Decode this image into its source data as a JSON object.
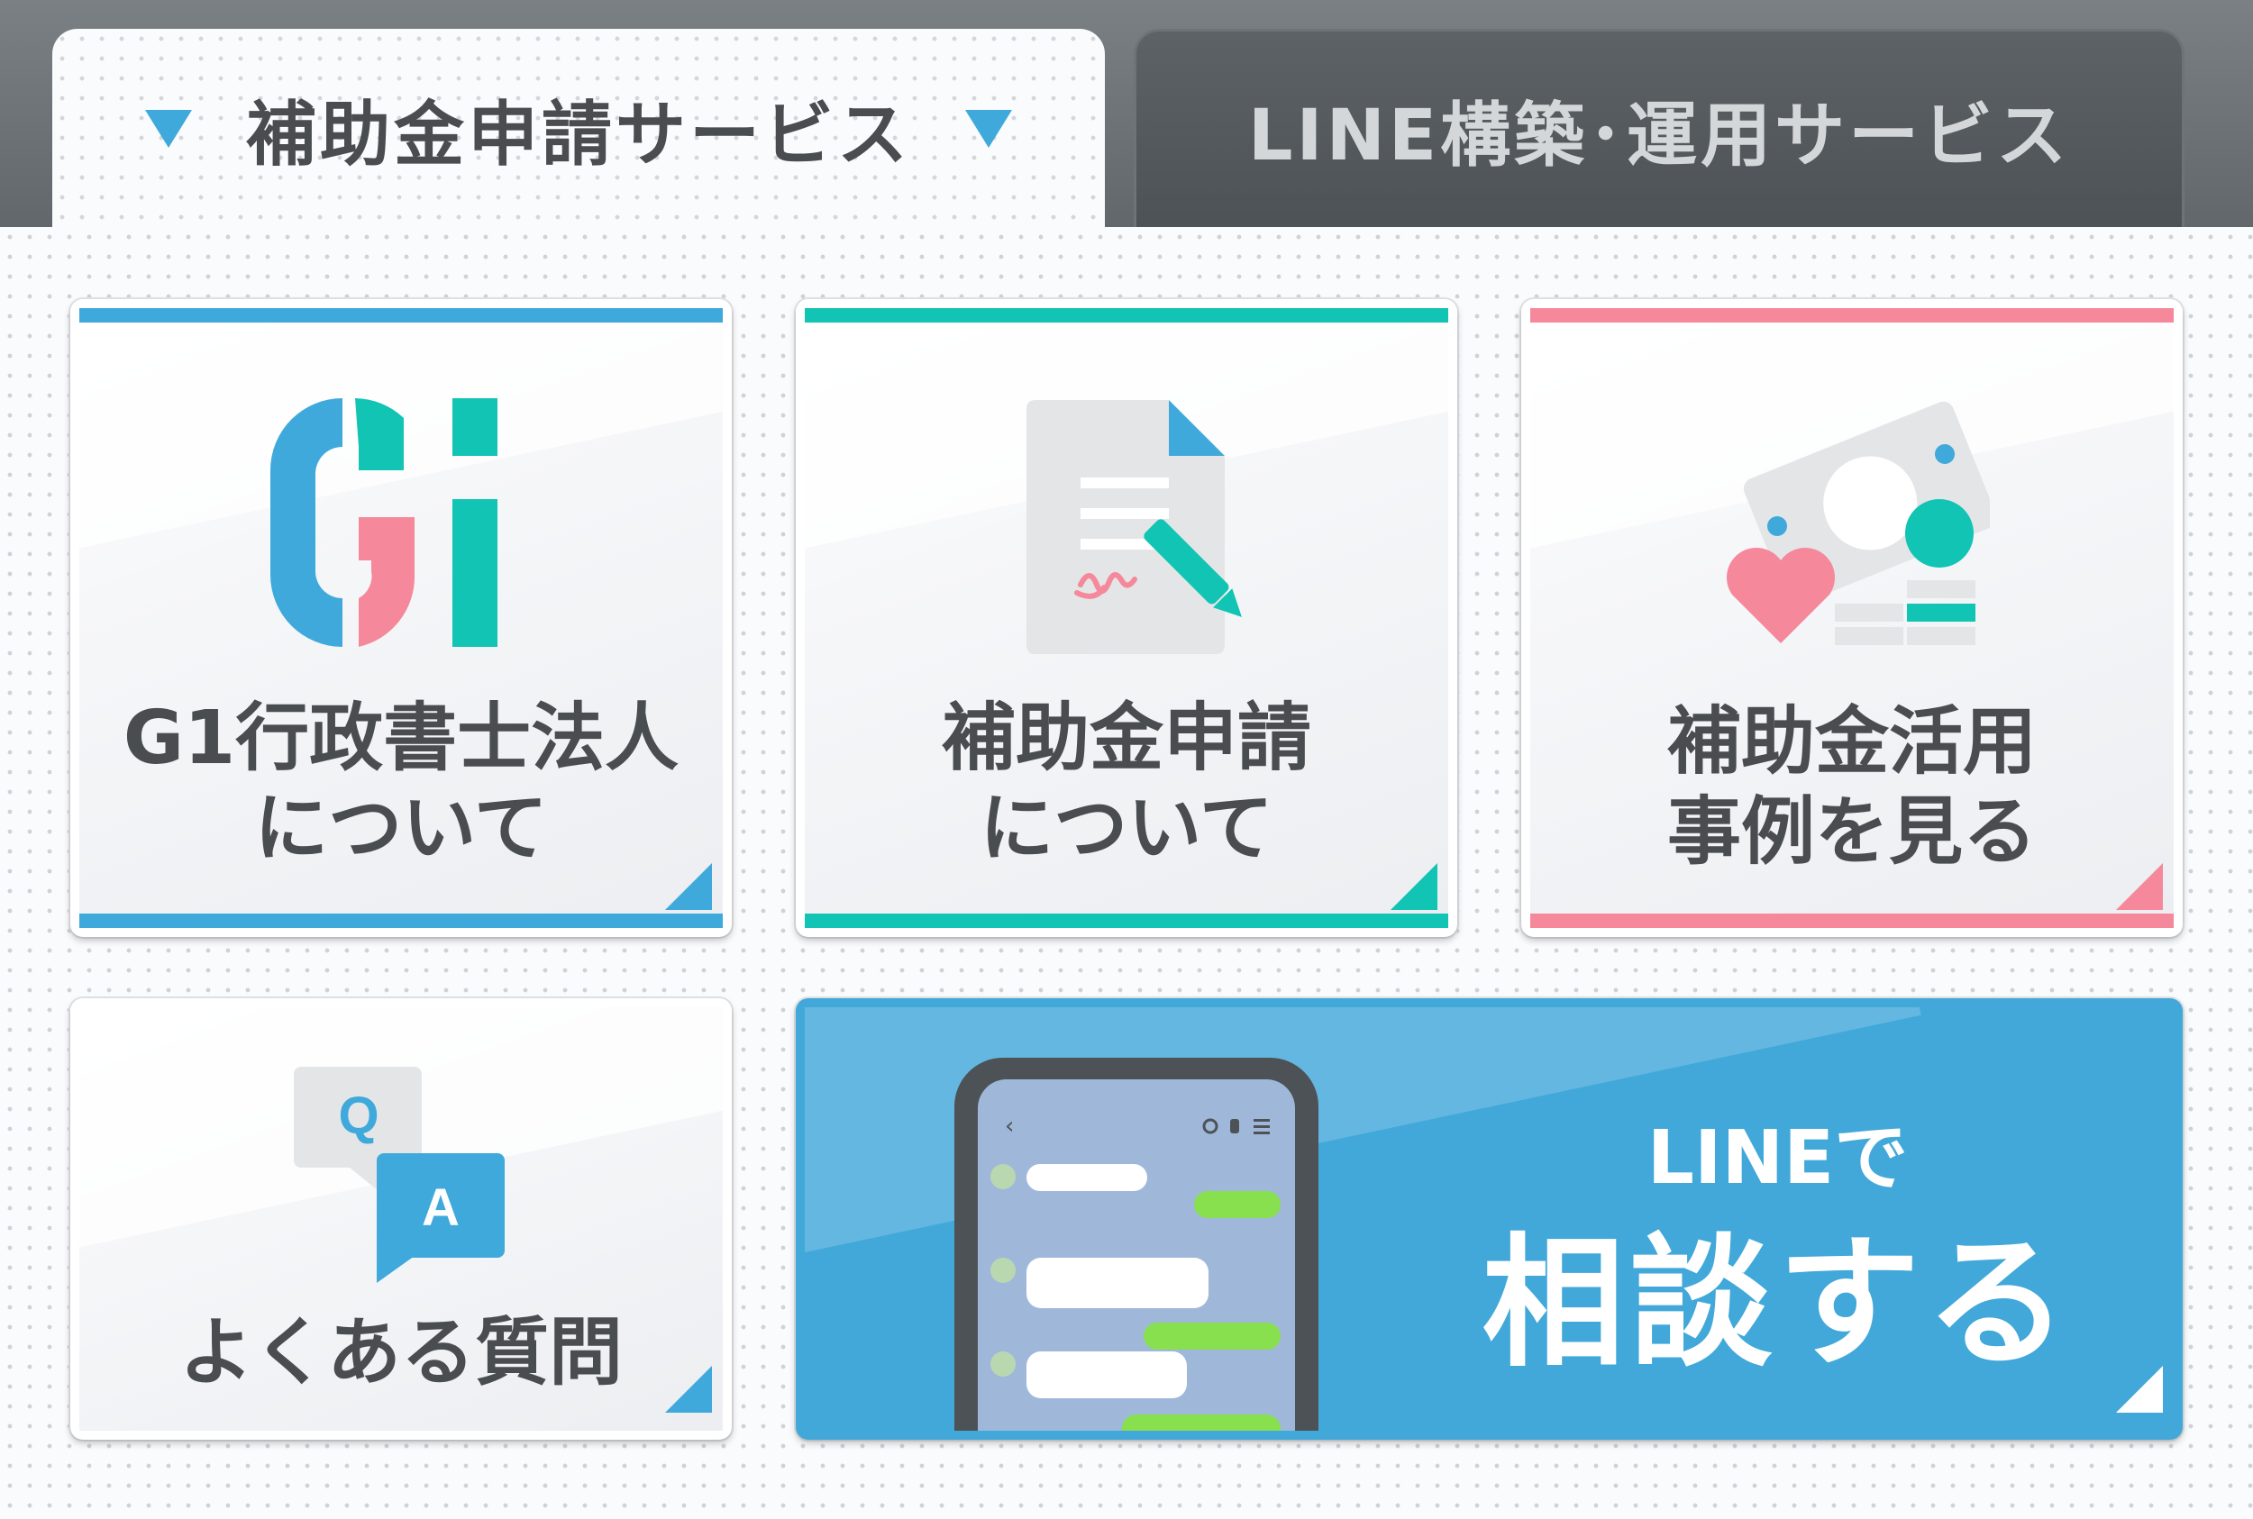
{
  "tabs": {
    "active_label": "補助金申請サービス",
    "inactive_label": "LINE構築･運用サービス"
  },
  "cards": {
    "about_firm": {
      "line1": "G1行政書士法人",
      "line2": "について",
      "accent": "#3fa9dc",
      "logo_text": "G1"
    },
    "about_subsidy": {
      "line1": "補助金申請",
      "line2": "について",
      "accent": "#11c4b4"
    },
    "case_studies": {
      "line1": "補助金活用",
      "line2": "事例を見る",
      "accent": "#f5889a"
    },
    "faq": {
      "label": "よくある質問",
      "accent": "#3fa9dc",
      "q": "Q",
      "a": "A"
    },
    "line_consult": {
      "small": "LINEで",
      "big": "相談する",
      "bg": "#41a8d9"
    }
  },
  "icons": [
    "chevron-down-icon",
    "g1-logo-icon",
    "document-pen-icon",
    "money-heart-icon",
    "qa-bubbles-icon",
    "smartphone-chat-icon",
    "corner-arrow-icon"
  ]
}
